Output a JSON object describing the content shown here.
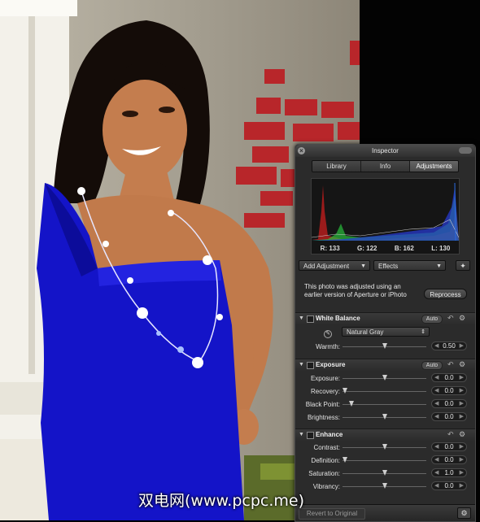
{
  "inspector": {
    "title": "Inspector",
    "tabs": [
      "Library",
      "Info",
      "Adjustments"
    ],
    "active_tab": "Adjustments",
    "histogram": {
      "r_label": "R: 133",
      "g_label": "G: 122",
      "b_label": "B: 162",
      "l_label": "L: 130"
    },
    "add_adjustment": "Add Adjustment",
    "effects": "Effects",
    "message": "This photo was adjusted using an earlier version of Aperture or iPhoto",
    "reprocess": "Reprocess",
    "white_balance": {
      "title": "White Balance",
      "auto": "Auto",
      "mode": "Natural Gray",
      "warmth_label": "Warmth:",
      "warmth_value": "0.50"
    },
    "exposure": {
      "title": "Exposure",
      "auto": "Auto",
      "rows": [
        {
          "label": "Exposure:",
          "value": "0.0"
        },
        {
          "label": "Recovery:",
          "value": "0.0"
        },
        {
          "label": "Black Point:",
          "value": "0.0"
        },
        {
          "label": "Brightness:",
          "value": "0.0"
        }
      ]
    },
    "enhance": {
      "title": "Enhance",
      "rows": [
        {
          "label": "Contrast:",
          "value": "0.0"
        },
        {
          "label": "Definition:",
          "value": "0.0"
        },
        {
          "label": "Saturation:",
          "value": "1.0"
        },
        {
          "label": "Vibrancy:",
          "value": "0.0"
        }
      ]
    },
    "revert": "Revert to Original"
  },
  "watermark": "双电网(www.pcpc.me)",
  "colors": {
    "dress": "#1414c8",
    "panel": "#2b2b2b",
    "brick": "#b8262a"
  }
}
